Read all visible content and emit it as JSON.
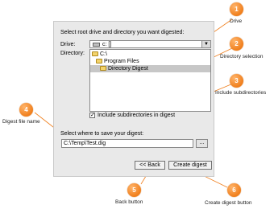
{
  "dialog": {
    "header": "Select root drive and directory you want digested:",
    "drive_label": "Drive:",
    "drive_value": "c: []",
    "directory_label": "Directory:",
    "directories": [
      "C:\\",
      "Program Files",
      "Directory Digest"
    ],
    "selected_directory": "Directory Digest",
    "include_subdirs_label": "Include subdirectories in digest",
    "include_subdirs_checked": true,
    "save_label": "Select where to save your digest:",
    "save_path": "C:\\Temp\\Test.dig",
    "browse_label": "...",
    "back_label": "<< Back",
    "create_label": "Create digest"
  },
  "annotations": [
    {
      "number": "1",
      "label": "Drive"
    },
    {
      "number": "2",
      "label": "Directory selection"
    },
    {
      "number": "3",
      "label": "Include subdirectories"
    },
    {
      "number": "4",
      "label": "Digest file name"
    },
    {
      "number": "5",
      "label": "Back button"
    },
    {
      "number": "6",
      "label": "Create digest button"
    }
  ],
  "colors": {
    "callout": "#f07f1d",
    "panel": "#e9e9e9",
    "selection": "#c7c7c7"
  },
  "icons": [
    "drive-icon",
    "folder-icon",
    "chevron-down-icon",
    "checkmark-icon"
  ]
}
